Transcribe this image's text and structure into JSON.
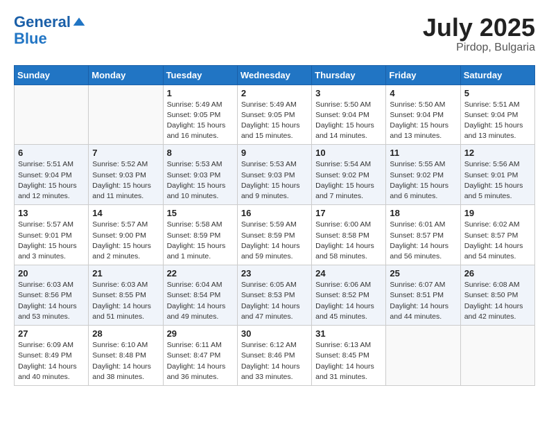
{
  "header": {
    "logo_line1": "General",
    "logo_line2": "Blue",
    "month_year": "July 2025",
    "location": "Pirdop, Bulgaria"
  },
  "days_of_week": [
    "Sunday",
    "Monday",
    "Tuesday",
    "Wednesday",
    "Thursday",
    "Friday",
    "Saturday"
  ],
  "weeks": [
    [
      {
        "day": "",
        "info": ""
      },
      {
        "day": "",
        "info": ""
      },
      {
        "day": "1",
        "info": "Sunrise: 5:49 AM\nSunset: 9:05 PM\nDaylight: 15 hours and 16 minutes."
      },
      {
        "day": "2",
        "info": "Sunrise: 5:49 AM\nSunset: 9:05 PM\nDaylight: 15 hours and 15 minutes."
      },
      {
        "day": "3",
        "info": "Sunrise: 5:50 AM\nSunset: 9:04 PM\nDaylight: 15 hours and 14 minutes."
      },
      {
        "day": "4",
        "info": "Sunrise: 5:50 AM\nSunset: 9:04 PM\nDaylight: 15 hours and 13 minutes."
      },
      {
        "day": "5",
        "info": "Sunrise: 5:51 AM\nSunset: 9:04 PM\nDaylight: 15 hours and 13 minutes."
      }
    ],
    [
      {
        "day": "6",
        "info": "Sunrise: 5:51 AM\nSunset: 9:04 PM\nDaylight: 15 hours and 12 minutes."
      },
      {
        "day": "7",
        "info": "Sunrise: 5:52 AM\nSunset: 9:03 PM\nDaylight: 15 hours and 11 minutes."
      },
      {
        "day": "8",
        "info": "Sunrise: 5:53 AM\nSunset: 9:03 PM\nDaylight: 15 hours and 10 minutes."
      },
      {
        "day": "9",
        "info": "Sunrise: 5:53 AM\nSunset: 9:03 PM\nDaylight: 15 hours and 9 minutes."
      },
      {
        "day": "10",
        "info": "Sunrise: 5:54 AM\nSunset: 9:02 PM\nDaylight: 15 hours and 7 minutes."
      },
      {
        "day": "11",
        "info": "Sunrise: 5:55 AM\nSunset: 9:02 PM\nDaylight: 15 hours and 6 minutes."
      },
      {
        "day": "12",
        "info": "Sunrise: 5:56 AM\nSunset: 9:01 PM\nDaylight: 15 hours and 5 minutes."
      }
    ],
    [
      {
        "day": "13",
        "info": "Sunrise: 5:57 AM\nSunset: 9:01 PM\nDaylight: 15 hours and 3 minutes."
      },
      {
        "day": "14",
        "info": "Sunrise: 5:57 AM\nSunset: 9:00 PM\nDaylight: 15 hours and 2 minutes."
      },
      {
        "day": "15",
        "info": "Sunrise: 5:58 AM\nSunset: 8:59 PM\nDaylight: 15 hours and 1 minute."
      },
      {
        "day": "16",
        "info": "Sunrise: 5:59 AM\nSunset: 8:59 PM\nDaylight: 14 hours and 59 minutes."
      },
      {
        "day": "17",
        "info": "Sunrise: 6:00 AM\nSunset: 8:58 PM\nDaylight: 14 hours and 58 minutes."
      },
      {
        "day": "18",
        "info": "Sunrise: 6:01 AM\nSunset: 8:57 PM\nDaylight: 14 hours and 56 minutes."
      },
      {
        "day": "19",
        "info": "Sunrise: 6:02 AM\nSunset: 8:57 PM\nDaylight: 14 hours and 54 minutes."
      }
    ],
    [
      {
        "day": "20",
        "info": "Sunrise: 6:03 AM\nSunset: 8:56 PM\nDaylight: 14 hours and 53 minutes."
      },
      {
        "day": "21",
        "info": "Sunrise: 6:03 AM\nSunset: 8:55 PM\nDaylight: 14 hours and 51 minutes."
      },
      {
        "day": "22",
        "info": "Sunrise: 6:04 AM\nSunset: 8:54 PM\nDaylight: 14 hours and 49 minutes."
      },
      {
        "day": "23",
        "info": "Sunrise: 6:05 AM\nSunset: 8:53 PM\nDaylight: 14 hours and 47 minutes."
      },
      {
        "day": "24",
        "info": "Sunrise: 6:06 AM\nSunset: 8:52 PM\nDaylight: 14 hours and 45 minutes."
      },
      {
        "day": "25",
        "info": "Sunrise: 6:07 AM\nSunset: 8:51 PM\nDaylight: 14 hours and 44 minutes."
      },
      {
        "day": "26",
        "info": "Sunrise: 6:08 AM\nSunset: 8:50 PM\nDaylight: 14 hours and 42 minutes."
      }
    ],
    [
      {
        "day": "27",
        "info": "Sunrise: 6:09 AM\nSunset: 8:49 PM\nDaylight: 14 hours and 40 minutes."
      },
      {
        "day": "28",
        "info": "Sunrise: 6:10 AM\nSunset: 8:48 PM\nDaylight: 14 hours and 38 minutes."
      },
      {
        "day": "29",
        "info": "Sunrise: 6:11 AM\nSunset: 8:47 PM\nDaylight: 14 hours and 36 minutes."
      },
      {
        "day": "30",
        "info": "Sunrise: 6:12 AM\nSunset: 8:46 PM\nDaylight: 14 hours and 33 minutes."
      },
      {
        "day": "31",
        "info": "Sunrise: 6:13 AM\nSunset: 8:45 PM\nDaylight: 14 hours and 31 minutes."
      },
      {
        "day": "",
        "info": ""
      },
      {
        "day": "",
        "info": ""
      }
    ]
  ]
}
